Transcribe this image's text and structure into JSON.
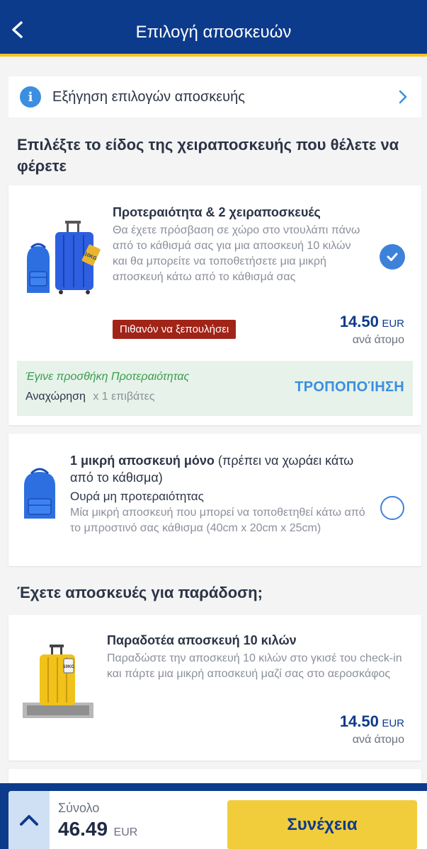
{
  "header": {
    "title": "Επιλογή αποσκευών",
    "back_icon": "chevron-left-icon"
  },
  "info_row": {
    "label": "Εξήγηση επιλογών αποσκευής",
    "icon": "info-icon",
    "chevron": "chevron-right-icon"
  },
  "section_cabin": {
    "heading": "Επιλέξτε το είδος της χειραποσκευής που θέλετε να φέρετε"
  },
  "option_priority": {
    "title": "Προτεραιότητα & 2 χειραποσκευές",
    "description": "Θα έχετε πρόσβαση σε χώρο στο ντουλάπι πάνω από το κάθισμά σας για μια αποσκευή 10 κιλών και θα μπορείτε να τοποθετήσετε μια μικρή αποσκευή κάτω από το κάθισμά σας",
    "badge": "Πιθανόν να ξεπουλήσει",
    "price": "14.50",
    "currency": "EUR",
    "per": "ανά άτομο",
    "tag_label": "10KG",
    "selected": true,
    "added_title": "Έγινε προσθήκη Προτεραιότητας",
    "added_direction": "Αναχώρηση",
    "added_passengers": "x 1 επιβάτες",
    "modify_label": "ΤΡΟΠΟΠΟΊΗΣΗ"
  },
  "option_small": {
    "title_bold": "1 μικρή αποσκευή μόνο",
    "title_normal": " (πρέπει να χωράει κάτω από το κάθισμα)",
    "subtitle": "Ουρά μη προτεραιότητας",
    "description": "Μία μικρή αποσκευή που μπορεί να τοποθετηθεί κάτω από το μπροστινό σας κάθισμα (40cm x 20cm x 25cm)",
    "selected": false
  },
  "section_checked": {
    "heading": "Έχετε αποσκευές για παράδοση;"
  },
  "option_checked": {
    "title": "Παραδοτέα αποσκευή 10 κιλών",
    "description": "Παραδώστε την αποσκευή 10 κιλών στο γκισέ του check-in και πάρτε μια μικρή αποσκευή μαζί σας στο αεροσκάφος",
    "price": "14.50",
    "currency": "EUR",
    "per": "ανά άτομο",
    "tag_label": "10KG"
  },
  "footer": {
    "total_label": "Σύνολο",
    "total_value": "46.49",
    "currency": "EUR",
    "continue_label": "Συνέχεια",
    "expand_icon": "chevron-up-icon"
  },
  "colors": {
    "brand_blue": "#0d3b8c",
    "accent_yellow": "#f5c625",
    "link_blue": "#3b8ee0",
    "badge_red": "#a12418",
    "success_green": "#3c9b4c"
  }
}
